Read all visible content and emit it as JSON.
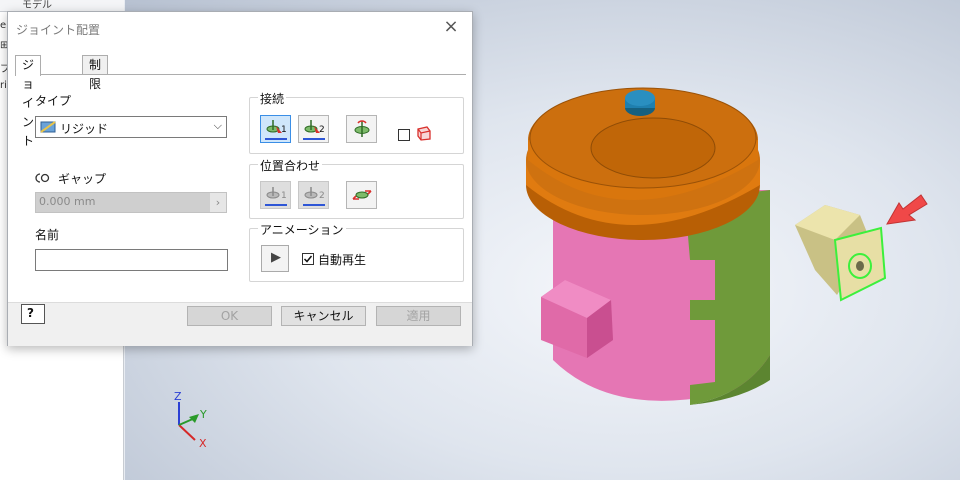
{
  "browser": {
    "tab_label": "モデル"
  },
  "dialog": {
    "title": "ジョイント配置",
    "close_glyph": "×",
    "tabs": [
      {
        "label": "ジョイント"
      },
      {
        "label": "制限"
      }
    ],
    "type": {
      "label": "タイプ",
      "value": "リジッド"
    },
    "gap": {
      "label": "ギャップ",
      "value": "0.000 mm"
    },
    "name": {
      "label": "名前",
      "value": ""
    },
    "connect": {
      "label": "接続",
      "btn1": "1",
      "btn2": "2"
    },
    "align": {
      "label": "位置合わせ",
      "btn1": "1",
      "btn2": "2"
    },
    "animation": {
      "label": "アニメーション",
      "auto_play_label": "自動再生",
      "auto_play_checked": true
    },
    "buttons": {
      "ok": "OK",
      "cancel": "キャンセル",
      "apply": "適用"
    }
  },
  "viewport": {
    "triad": {
      "x": "X",
      "y": "Y",
      "z": "Z"
    }
  },
  "colors": {
    "lid_orange": "#e07b10",
    "body_pink": "#e576b4",
    "body_green": "#6f9a3a",
    "knob_blue": "#1f7fae",
    "part_tan": "#e7dfa5",
    "highlight_green": "#3cf03c",
    "arrow_red": "#f04848",
    "selected_button": "#cfe6fb"
  }
}
